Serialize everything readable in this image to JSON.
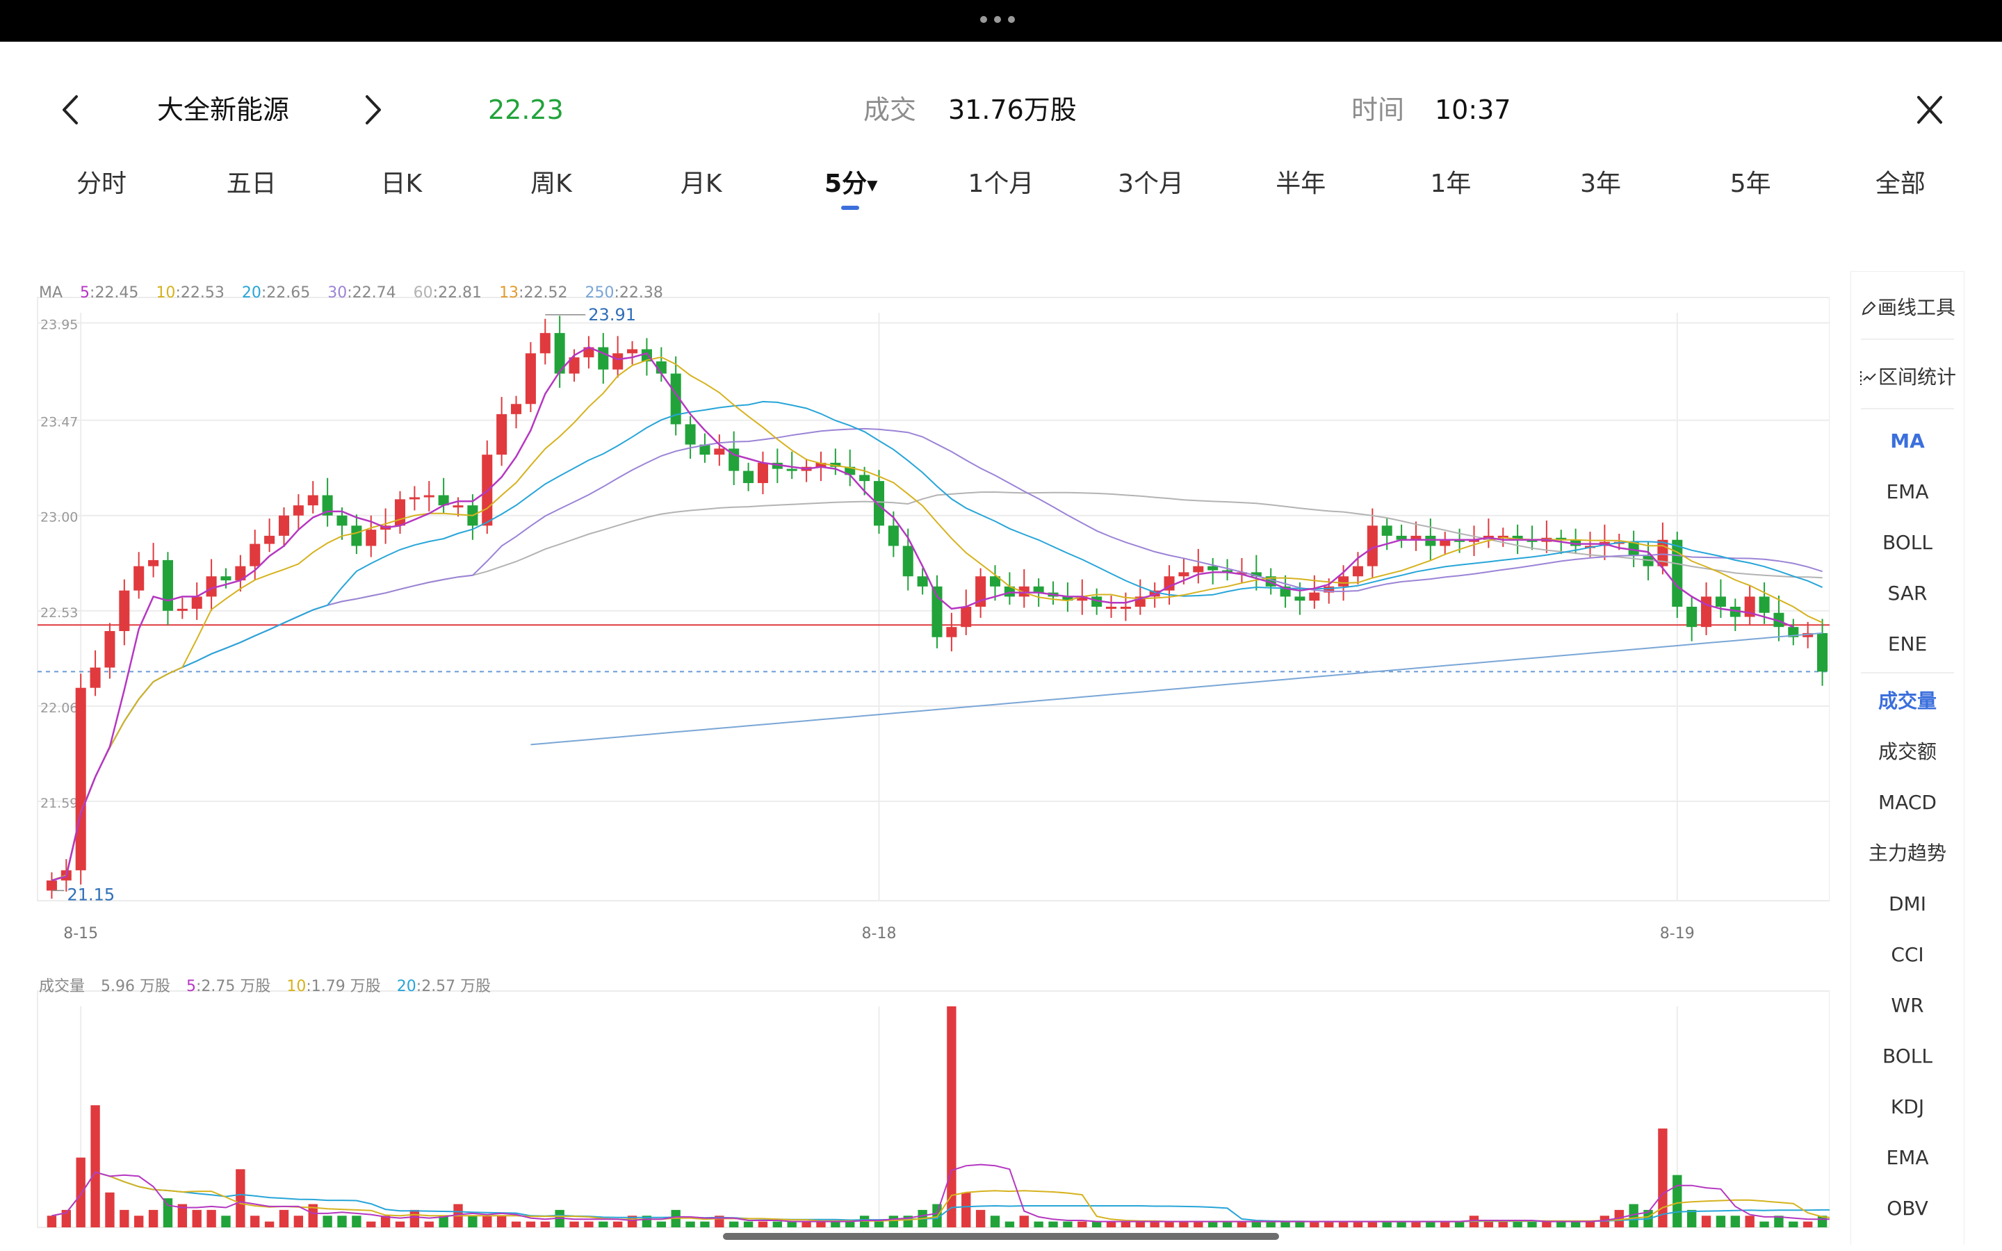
{
  "header": {
    "stock_name": "大全新能源",
    "price": "22.23",
    "volume_label": "成交",
    "volume_value": "31.76万股",
    "time_label": "时间",
    "time_value": "10:37"
  },
  "tabs": [
    "分时",
    "五日",
    "日K",
    "周K",
    "月K",
    "5分",
    "1个月",
    "3个月",
    "半年",
    "1年",
    "3年",
    "5年",
    "全部"
  ],
  "active_tab_index": 5,
  "colors": {
    "up": "#e03a3e",
    "down": "#21a33a",
    "accent": "#3b6fdc",
    "ma5": "#b537c1",
    "ma10": "#d6b21e",
    "ma20": "#27a5d8",
    "ma30": "#9b83d6",
    "ma60": "#b3b3b3",
    "ma13": "#e49a2d",
    "ma250": "#7aa6d6"
  },
  "ma_legend": {
    "label": "MA",
    "items": [
      {
        "key": "5",
        "value": ":22.45",
        "color": "#b537c1"
      },
      {
        "key": "10",
        "value": ":22.53",
        "color": "#d6b21e"
      },
      {
        "key": "20",
        "value": ":22.65",
        "color": "#27a5d8"
      },
      {
        "key": "30",
        "value": ":22.74",
        "color": "#9b83d6"
      },
      {
        "key": "60",
        "value": ":22.81",
        "color": "#b3b3b3"
      },
      {
        "key": "13",
        "value": ":22.52",
        "color": "#e49a2d"
      },
      {
        "key": "250",
        "value": ":22.38",
        "color": "#7aa6d6"
      }
    ]
  },
  "volume_legend": {
    "label": "成交量",
    "current": "5.96 万股",
    "items": [
      {
        "key": "5",
        "value": ":2.75 万股",
        "color": "#b537c1"
      },
      {
        "key": "10",
        "value": ":1.79 万股",
        "color": "#d6b21e"
      },
      {
        "key": "20",
        "value": ":2.57 万股",
        "color": "#27a5d8"
      }
    ]
  },
  "chart_data": {
    "type": "candlestick",
    "interval": "5分",
    "y_ticks": [
      "23.95",
      "23.47",
      "23.00",
      "22.53",
      "22.06",
      "21.59"
    ],
    "y_tick_values": [
      23.95,
      23.47,
      23.0,
      22.53,
      22.06,
      21.59
    ],
    "ylim": [
      21.1,
      24.0
    ],
    "x_labels": [
      "8-15",
      "8-18",
      "8-19"
    ],
    "x_label_positions": [
      2,
      57,
      112
    ],
    "high_label": "23.91",
    "low_label": "21.15",
    "current_price": 22.23,
    "reference_price": 22.46,
    "closes": [
      21.2,
      21.25,
      22.15,
      22.25,
      22.43,
      22.63,
      22.75,
      22.78,
      22.53,
      22.54,
      22.6,
      22.7,
      22.68,
      22.75,
      22.86,
      22.9,
      23.0,
      23.05,
      23.1,
      23.0,
      22.95,
      22.85,
      22.93,
      22.95,
      23.08,
      23.09,
      23.1,
      23.05,
      23.05,
      22.95,
      23.3,
      23.5,
      23.55,
      23.8,
      23.9,
      23.7,
      23.78,
      23.83,
      23.72,
      23.8,
      23.82,
      23.76,
      23.7,
      23.45,
      23.35,
      23.3,
      23.33,
      23.22,
      23.16,
      23.26,
      23.23,
      23.22,
      23.24,
      23.26,
      23.24,
      23.2,
      23.17,
      22.95,
      22.85,
      22.7,
      22.65,
      22.4,
      22.45,
      22.55,
      22.7,
      22.65,
      22.6,
      22.65,
      22.62,
      22.6,
      22.58,
      22.6,
      22.55,
      22.55,
      22.55,
      22.6,
      22.63,
      22.7,
      22.72,
      22.75,
      22.73,
      22.72,
      22.72,
      22.7,
      22.65,
      22.6,
      22.58,
      22.62,
      22.65,
      22.7,
      22.75,
      22.95,
      22.9,
      22.88,
      22.9,
      22.85,
      22.88,
      22.87,
      22.88,
      22.9,
      22.9,
      22.88,
      22.87,
      22.89,
      22.88,
      22.85,
      22.85,
      22.87,
      22.87,
      22.8,
      22.75,
      22.88,
      22.55,
      22.45,
      22.6,
      22.55,
      22.5,
      22.6,
      22.52,
      22.45,
      22.4,
      22.42,
      22.23
    ],
    "ma5": [
      21.2,
      21.22,
      21.53,
      21.71,
      21.86,
      22.14,
      22.44,
      22.6,
      22.58,
      22.6,
      22.6,
      22.64,
      22.66,
      22.68,
      22.73,
      22.8,
      22.85,
      22.93,
      22.99,
      23.02,
      23.02,
      22.99,
      22.97,
      22.94,
      22.95,
      22.98,
      23.01,
      23.05,
      23.07,
      23.07,
      23.12,
      23.19,
      23.29,
      23.42,
      23.6,
      23.71,
      23.79,
      23.83,
      23.8,
      23.77,
      23.78,
      23.8,
      23.7,
      23.6,
      23.5,
      23.42,
      23.35,
      23.3,
      23.28,
      23.26,
      23.25,
      23.24,
      23.23,
      23.24,
      23.23,
      23.2,
      23.12,
      23.05,
      22.99,
      22.89,
      22.75,
      22.6,
      22.54,
      22.55,
      22.58,
      22.6,
      22.62,
      22.62,
      22.62,
      22.61,
      22.6,
      22.6,
      22.58,
      22.57,
      22.57,
      22.59,
      22.61,
      22.65,
      22.68,
      22.71,
      22.72,
      22.72,
      22.71,
      22.69,
      22.67,
      22.64,
      22.63,
      22.64,
      22.66,
      22.72,
      22.79,
      22.84,
      22.86,
      22.88,
      22.88,
      22.88,
      22.88,
      22.88,
      22.88,
      22.89,
      22.88,
      22.88,
      22.88,
      22.88,
      22.87,
      22.86,
      22.86,
      22.86,
      22.84,
      22.83,
      22.82,
      22.74,
      22.65,
      22.6,
      22.56,
      22.54,
      22.53,
      22.52,
      22.5,
      22.48,
      22.45
    ],
    "volume_ticks_note": "",
    "volumes": [
      2,
      3,
      12,
      21,
      6,
      3,
      2,
      3,
      5,
      4,
      3,
      3,
      2,
      10,
      2,
      1,
      3,
      2,
      4,
      2,
      2,
      2,
      1,
      2,
      1,
      3,
      1,
      2,
      4,
      2,
      2,
      2,
      1,
      1,
      1,
      3,
      1,
      1,
      1,
      1,
      2,
      2,
      1,
      3,
      1,
      1,
      2,
      1,
      1,
      1,
      1,
      1,
      1,
      1,
      1,
      1,
      2,
      1,
      2,
      2,
      3,
      4,
      38,
      6,
      3,
      2,
      1,
      2,
      1,
      1,
      1,
      1,
      1,
      1,
      1,
      1,
      1,
      1,
      1,
      1,
      1,
      1,
      1,
      1,
      1,
      1,
      1,
      1,
      1,
      1,
      1,
      1,
      1,
      1,
      1,
      1,
      1,
      1,
      2,
      1,
      1,
      1,
      1,
      1,
      1,
      1,
      1,
      2,
      3,
      4,
      3,
      17,
      9,
      3,
      2,
      2,
      2,
      2,
      1,
      2,
      1,
      1,
      2,
      1,
      6
    ]
  },
  "side_panel": {
    "tools": [
      {
        "icon": "pen-icon",
        "label": "画线工具"
      },
      {
        "icon": "range-icon",
        "label": "区间统计"
      }
    ],
    "main_indicators": [
      "MA",
      "EMA",
      "BOLL",
      "SAR",
      "ENE"
    ],
    "active_main": "MA",
    "sub_indicators": [
      "成交量",
      "成交额",
      "MACD",
      "主力趋势",
      "DMI",
      "CCI",
      "WR",
      "BOLL",
      "KDJ",
      "EMA",
      "OBV"
    ],
    "active_sub": "成交量"
  }
}
